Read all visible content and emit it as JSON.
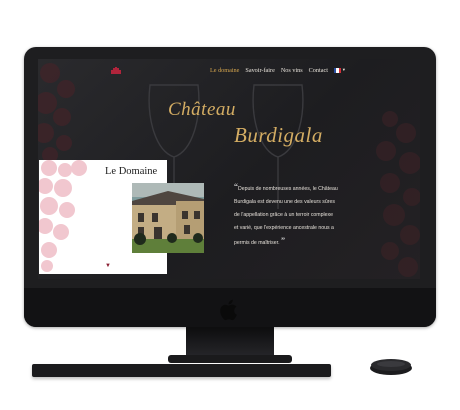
{
  "nav": {
    "links": [
      "Le domaine",
      "Savoir-faire",
      "Nos vins",
      "Contact"
    ],
    "active_index": 0,
    "language_flag": "french-flag-icon"
  },
  "hero": {
    "title_line1": "Château",
    "title_line2": "Burdigala"
  },
  "domaine_card": {
    "title": "Le Domaine",
    "chevron_icon": "chevron-down-icon"
  },
  "quote": {
    "open_mark": "“",
    "text": "Depuis de nombreuses années, le Château Burdigala est devenu une des valeurs sûres de l'appellation grâce à un terroir complexe et varié, que l'expérience ancestrale nous a permis de maîtriser.",
    "close_mark": "”"
  },
  "device": {
    "logo_icon": "apple-logo-icon"
  },
  "colors": {
    "gold": "#d4ad63",
    "accent": "#d6a64e",
    "wine": "#8a1f33",
    "screen_bg": "#242427"
  }
}
